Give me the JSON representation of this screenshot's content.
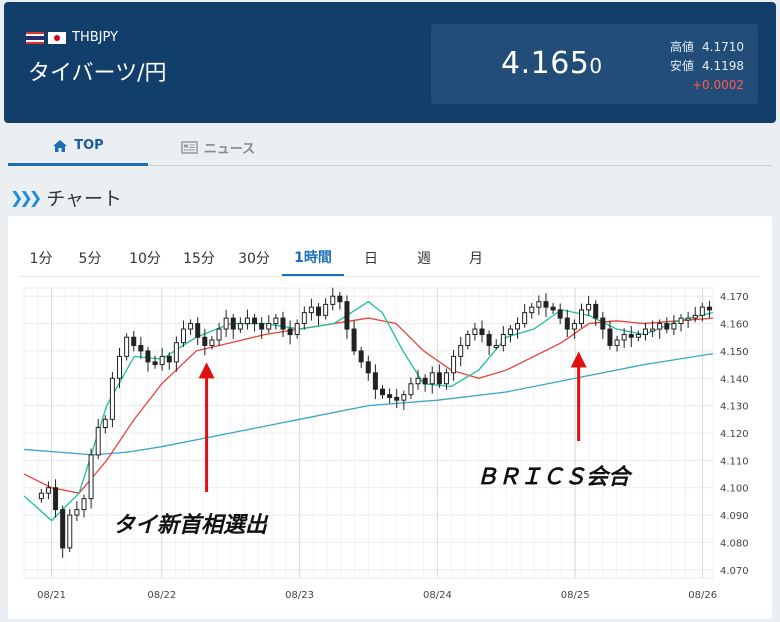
{
  "header": {
    "flags": [
      "thailand-flag-icon",
      "japan-flag-icon"
    ],
    "code": "THBJPY",
    "name": "タイバーツ/円",
    "price_main": "4.165",
    "price_small": "0",
    "high_label": "高値",
    "high_value": "4.1710",
    "low_label": "安値",
    "low_value": "4.1198",
    "change": "+0.0002"
  },
  "tabs": [
    {
      "label": "TOP",
      "icon": "home-icon",
      "active": true
    },
    {
      "label": "ニュース",
      "icon": "news-icon",
      "active": false
    }
  ],
  "section": {
    "title": "チャート",
    "icon": "double-chevron-right-icon"
  },
  "periods": [
    "1分",
    "5分",
    "10分",
    "15分",
    "30分",
    "1時間",
    "日",
    "週",
    "月"
  ],
  "active_period": "1時間",
  "colors": {
    "header_bg": "#123e6c",
    "accent": "#1d6fb8",
    "candle": "#222222",
    "ma_short": "#1fbf9c",
    "ma_mid": "#e8423c",
    "ma_long": "#3aa6c8",
    "arrow": "#e01010",
    "change_up": "#ff5a4d"
  },
  "chart_data": {
    "type": "candlestick",
    "xlabel": "",
    "ylabel": "",
    "ylim": [
      4.067,
      4.173
    ],
    "y_ticks": [
      "4.170",
      "4.160",
      "4.150",
      "4.140",
      "4.130",
      "4.120",
      "4.110",
      "4.100",
      "4.090",
      "4.080",
      "4.070"
    ],
    "x_ticks": [
      "08/21",
      "08/22",
      "08/23",
      "08/24",
      "08/25",
      "08/26"
    ],
    "grid": true,
    "candles_close": [
      4.098,
      4.1,
      4.092,
      4.078,
      4.09,
      4.092,
      4.096,
      4.112,
      4.122,
      4.125,
      4.14,
      4.148,
      4.155,
      4.152,
      4.15,
      4.146,
      4.145,
      4.148,
      4.146,
      4.153,
      4.158,
      4.16,
      4.155,
      4.152,
      4.154,
      4.158,
      4.162,
      4.158,
      4.16,
      4.162,
      4.16,
      4.158,
      4.16,
      4.162,
      4.158,
      4.156,
      4.16,
      4.164,
      4.166,
      4.163,
      4.167,
      4.17,
      4.168,
      4.158,
      4.15,
      4.146,
      4.142,
      4.136,
      4.134,
      4.133,
      4.132,
      4.134,
      4.138,
      4.14,
      4.138,
      4.142,
      4.138,
      4.142,
      4.148,
      4.152,
      4.156,
      4.158,
      4.156,
      4.152,
      4.152,
      4.156,
      4.158,
      4.16,
      4.164,
      4.166,
      4.168,
      4.166,
      4.165,
      4.162,
      4.158,
      4.16,
      4.165,
      4.167,
      4.162,
      4.158,
      4.152,
      4.154,
      4.156,
      4.155,
      4.156,
      4.158,
      4.158,
      4.16,
      4.158,
      4.16,
      4.162,
      4.162,
      4.163,
      4.166,
      4.165
    ],
    "series": [
      {
        "name": "",
        "color": "#1fbf9c",
        "x_frac": [
          0,
          0.04,
          0.08,
          0.12,
          0.16,
          0.2,
          0.25,
          0.3,
          0.35,
          0.4,
          0.45,
          0.5,
          0.52,
          0.55,
          0.58,
          0.62,
          0.66,
          0.7,
          0.74,
          0.78,
          0.82,
          0.86,
          0.9,
          0.95,
          1.0
        ],
        "values": [
          4.097,
          4.088,
          4.098,
          4.13,
          4.148,
          4.147,
          4.155,
          4.16,
          4.16,
          4.158,
          4.16,
          4.168,
          4.164,
          4.15,
          4.138,
          4.137,
          4.143,
          4.155,
          4.158,
          4.165,
          4.163,
          4.158,
          4.156,
          4.161,
          4.164
        ]
      },
      {
        "name": "",
        "color": "#e8423c",
        "x_frac": [
          0,
          0.04,
          0.08,
          0.12,
          0.16,
          0.2,
          0.25,
          0.3,
          0.35,
          0.4,
          0.45,
          0.5,
          0.54,
          0.58,
          0.62,
          0.66,
          0.7,
          0.74,
          0.78,
          0.82,
          0.86,
          0.9,
          0.95,
          1.0
        ],
        "values": [
          4.105,
          4.1,
          4.098,
          4.11,
          4.125,
          4.138,
          4.15,
          4.153,
          4.156,
          4.158,
          4.16,
          4.162,
          4.16,
          4.15,
          4.143,
          4.14,
          4.143,
          4.148,
          4.153,
          4.16,
          4.161,
          4.16,
          4.161,
          4.162
        ]
      },
      {
        "name": "",
        "color": "#3aa6c8",
        "x_frac": [
          0,
          0.05,
          0.1,
          0.15,
          0.2,
          0.3,
          0.4,
          0.5,
          0.55,
          0.6,
          0.7,
          0.8,
          0.9,
          1.0
        ],
        "values": [
          4.114,
          4.113,
          4.112,
          4.113,
          4.115,
          4.12,
          4.125,
          4.13,
          4.131,
          4.132,
          4.135,
          4.14,
          4.145,
          4.149
        ]
      }
    ],
    "annotations": [
      {
        "text": "タイ新首相選出",
        "arrow_at": "08/22",
        "points_to": 4.148
      },
      {
        "text": "ＢＲＩＣＳ会合",
        "arrow_at": "08/25",
        "points_to": 4.152
      }
    ]
  }
}
